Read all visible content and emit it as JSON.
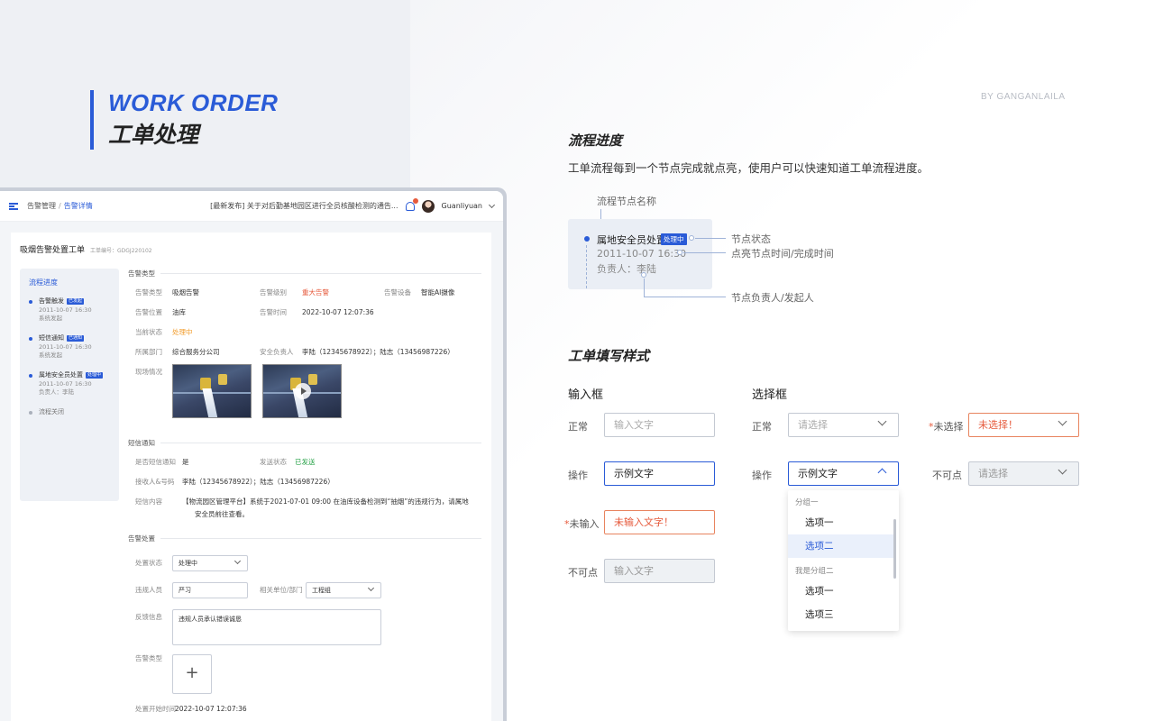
{
  "hero": {
    "en": "WORK ORDER",
    "cn": "工单处理"
  },
  "byline": "BY GANGANLAILA",
  "mock": {
    "breadcrumb": [
      "告警管理",
      "告警详情"
    ],
    "notice": "[最新发布] 关于对后勤基地园区进行全员核酸检测的通告...",
    "user": "Guanliyuan",
    "card_title": "吸烟告警处置工单",
    "order_no": "工单编号：GDGJ220102",
    "steps_title": "流程进度",
    "steps": [
      {
        "name": "告警触发",
        "tag": "已发起",
        "time": "2011-10-07 16:30",
        "note": "系统发起"
      },
      {
        "name": "短信通知",
        "tag": "已通知",
        "time": "2011-10-07 16:30",
        "note": "系统发起"
      },
      {
        "name": "属地安全员处置",
        "tag": "处理中",
        "time": "2011-10-07 16:30",
        "note": "负责人：李陆"
      },
      {
        "name": "流程关闭"
      }
    ],
    "sections": {
      "alarm_type": "告警类型",
      "sms": "短信通知",
      "handle": "告警处置"
    },
    "fields": {
      "type_lbl": "告警类型",
      "type_val": "吸烟告警",
      "level_lbl": "告警级别",
      "level_val": "重大告警",
      "device_lbl": "告警设备",
      "device_val": "智能AI摄像",
      "loc_lbl": "告警位置",
      "loc_val": "油库",
      "time_lbl": "告警时间",
      "time_val": "2022-10-07 12:07:36",
      "state_lbl": "当前状态",
      "state_val": "处理中",
      "dept_lbl": "所属部门",
      "dept_val": "综合服务分公司",
      "safety_lbl": "安全负责人",
      "safety_val": "李陆（12345678922）；陆志（13456987226）",
      "scene_lbl": "现场情况",
      "sms_lbl": "是否短信通知",
      "sms_val": "是",
      "send_lbl": "发送状态",
      "send_val": "已发送",
      "recv_lbl": "接收人&号码",
      "recv_val": "李陆（12345678922）；陆志（13456987226）",
      "content_lbl": "短信内容",
      "content_val1": "【物流园区管理平台】系统于2021-07-01 09:00 在油库设备检测到“抽烟”的违规行为，请属地",
      "content_val2": "安全员前往查看。",
      "hstate_lbl": "处置状态",
      "hstate_val": "处理中",
      "violator_lbl": "违规人员",
      "violator_val": "严习",
      "unit_lbl": "相关单位/部门",
      "unit_val": "工程组",
      "feedback_lbl": "反馈信息",
      "feedback_val": "违规人员承认错误诚恳",
      "atype_lbl": "告警类型",
      "start_lbl": "处置开始时间",
      "start_val": "2022-10-07 12:07:36"
    }
  },
  "flow": {
    "title": "流程进度",
    "desc": "工单流程每到一个节点完成就点亮，使用户可以快速知道工单流程进度。",
    "node_name_label": "流程节点名称",
    "demo_name": "属地安全员处置",
    "demo_tag": "处理中",
    "demo_time": "2011-10-07 16:30",
    "demo_owner": "负责人：李陆",
    "ann_state": "节点状态",
    "ann_time": "点亮节点时间/完成时间",
    "ann_owner": "节点负责人/发起人"
  },
  "form": {
    "title": "工单填写样式",
    "input_col": "输入框",
    "select_col": "选择框",
    "lbl_normal": "正常",
    "lbl_operate": "操作",
    "lbl_missing": "未输入",
    "lbl_disabled": "不可点",
    "lbl_unselected": "未选择",
    "input_placeholder": "输入文字",
    "input_example": "示例文字",
    "input_error": "未输入文字！",
    "select_placeholder": "请选择",
    "select_example": "示例文字",
    "select_error": "未选择！",
    "dropdown": {
      "group1": "分组一",
      "group2": "我是分组二",
      "g1_items": [
        "选项一",
        "选项二"
      ],
      "g2_items": [
        "选项一",
        "选项三"
      ]
    }
  },
  "colors": {
    "accent": "#2a5bd7",
    "error": "#e65a3c",
    "warning": "#f29c2b",
    "success": "#2aa34a"
  }
}
